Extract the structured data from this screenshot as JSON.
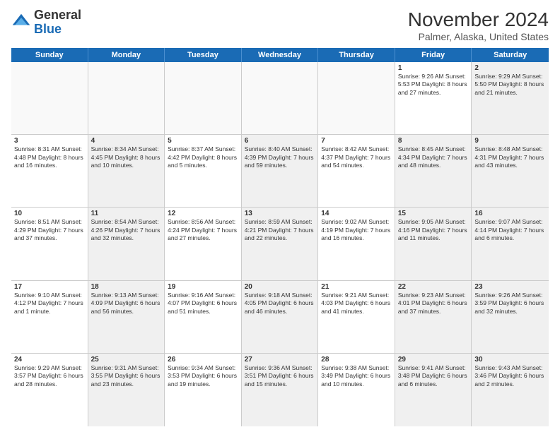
{
  "header": {
    "logo_general": "General",
    "logo_blue": "Blue",
    "month_title": "November 2024",
    "location": "Palmer, Alaska, United States"
  },
  "weekdays": [
    "Sunday",
    "Monday",
    "Tuesday",
    "Wednesday",
    "Thursday",
    "Friday",
    "Saturday"
  ],
  "rows": [
    [
      {
        "day": "",
        "info": "",
        "shaded": true
      },
      {
        "day": "",
        "info": "",
        "shaded": true
      },
      {
        "day": "",
        "info": "",
        "shaded": true
      },
      {
        "day": "",
        "info": "",
        "shaded": true
      },
      {
        "day": "",
        "info": "",
        "shaded": true
      },
      {
        "day": "1",
        "info": "Sunrise: 9:26 AM\nSunset: 5:53 PM\nDaylight: 8 hours and 27 minutes.",
        "shaded": false
      },
      {
        "day": "2",
        "info": "Sunrise: 9:29 AM\nSunset: 5:50 PM\nDaylight: 8 hours and 21 minutes.",
        "shaded": true
      }
    ],
    [
      {
        "day": "3",
        "info": "Sunrise: 8:31 AM\nSunset: 4:48 PM\nDaylight: 8 hours and 16 minutes.",
        "shaded": false
      },
      {
        "day": "4",
        "info": "Sunrise: 8:34 AM\nSunset: 4:45 PM\nDaylight: 8 hours and 10 minutes.",
        "shaded": true
      },
      {
        "day": "5",
        "info": "Sunrise: 8:37 AM\nSunset: 4:42 PM\nDaylight: 8 hours and 5 minutes.",
        "shaded": false
      },
      {
        "day": "6",
        "info": "Sunrise: 8:40 AM\nSunset: 4:39 PM\nDaylight: 7 hours and 59 minutes.",
        "shaded": true
      },
      {
        "day": "7",
        "info": "Sunrise: 8:42 AM\nSunset: 4:37 PM\nDaylight: 7 hours and 54 minutes.",
        "shaded": false
      },
      {
        "day": "8",
        "info": "Sunrise: 8:45 AM\nSunset: 4:34 PM\nDaylight: 7 hours and 48 minutes.",
        "shaded": true
      },
      {
        "day": "9",
        "info": "Sunrise: 8:48 AM\nSunset: 4:31 PM\nDaylight: 7 hours and 43 minutes.",
        "shaded": true
      }
    ],
    [
      {
        "day": "10",
        "info": "Sunrise: 8:51 AM\nSunset: 4:29 PM\nDaylight: 7 hours and 37 minutes.",
        "shaded": false
      },
      {
        "day": "11",
        "info": "Sunrise: 8:54 AM\nSunset: 4:26 PM\nDaylight: 7 hours and 32 minutes.",
        "shaded": true
      },
      {
        "day": "12",
        "info": "Sunrise: 8:56 AM\nSunset: 4:24 PM\nDaylight: 7 hours and 27 minutes.",
        "shaded": false
      },
      {
        "day": "13",
        "info": "Sunrise: 8:59 AM\nSunset: 4:21 PM\nDaylight: 7 hours and 22 minutes.",
        "shaded": true
      },
      {
        "day": "14",
        "info": "Sunrise: 9:02 AM\nSunset: 4:19 PM\nDaylight: 7 hours and 16 minutes.",
        "shaded": false
      },
      {
        "day": "15",
        "info": "Sunrise: 9:05 AM\nSunset: 4:16 PM\nDaylight: 7 hours and 11 minutes.",
        "shaded": true
      },
      {
        "day": "16",
        "info": "Sunrise: 9:07 AM\nSunset: 4:14 PM\nDaylight: 7 hours and 6 minutes.",
        "shaded": true
      }
    ],
    [
      {
        "day": "17",
        "info": "Sunrise: 9:10 AM\nSunset: 4:12 PM\nDaylight: 7 hours and 1 minute.",
        "shaded": false
      },
      {
        "day": "18",
        "info": "Sunrise: 9:13 AM\nSunset: 4:09 PM\nDaylight: 6 hours and 56 minutes.",
        "shaded": true
      },
      {
        "day": "19",
        "info": "Sunrise: 9:16 AM\nSunset: 4:07 PM\nDaylight: 6 hours and 51 minutes.",
        "shaded": false
      },
      {
        "day": "20",
        "info": "Sunrise: 9:18 AM\nSunset: 4:05 PM\nDaylight: 6 hours and 46 minutes.",
        "shaded": true
      },
      {
        "day": "21",
        "info": "Sunrise: 9:21 AM\nSunset: 4:03 PM\nDaylight: 6 hours and 41 minutes.",
        "shaded": false
      },
      {
        "day": "22",
        "info": "Sunrise: 9:23 AM\nSunset: 4:01 PM\nDaylight: 6 hours and 37 minutes.",
        "shaded": true
      },
      {
        "day": "23",
        "info": "Sunrise: 9:26 AM\nSunset: 3:59 PM\nDaylight: 6 hours and 32 minutes.",
        "shaded": true
      }
    ],
    [
      {
        "day": "24",
        "info": "Sunrise: 9:29 AM\nSunset: 3:57 PM\nDaylight: 6 hours and 28 minutes.",
        "shaded": false
      },
      {
        "day": "25",
        "info": "Sunrise: 9:31 AM\nSunset: 3:55 PM\nDaylight: 6 hours and 23 minutes.",
        "shaded": true
      },
      {
        "day": "26",
        "info": "Sunrise: 9:34 AM\nSunset: 3:53 PM\nDaylight: 6 hours and 19 minutes.",
        "shaded": false
      },
      {
        "day": "27",
        "info": "Sunrise: 9:36 AM\nSunset: 3:51 PM\nDaylight: 6 hours and 15 minutes.",
        "shaded": true
      },
      {
        "day": "28",
        "info": "Sunrise: 9:38 AM\nSunset: 3:49 PM\nDaylight: 6 hours and 10 minutes.",
        "shaded": false
      },
      {
        "day": "29",
        "info": "Sunrise: 9:41 AM\nSunset: 3:48 PM\nDaylight: 6 hours and 6 minutes.",
        "shaded": true
      },
      {
        "day": "30",
        "info": "Sunrise: 9:43 AM\nSunset: 3:46 PM\nDaylight: 6 hours and 2 minutes.",
        "shaded": true
      }
    ]
  ]
}
